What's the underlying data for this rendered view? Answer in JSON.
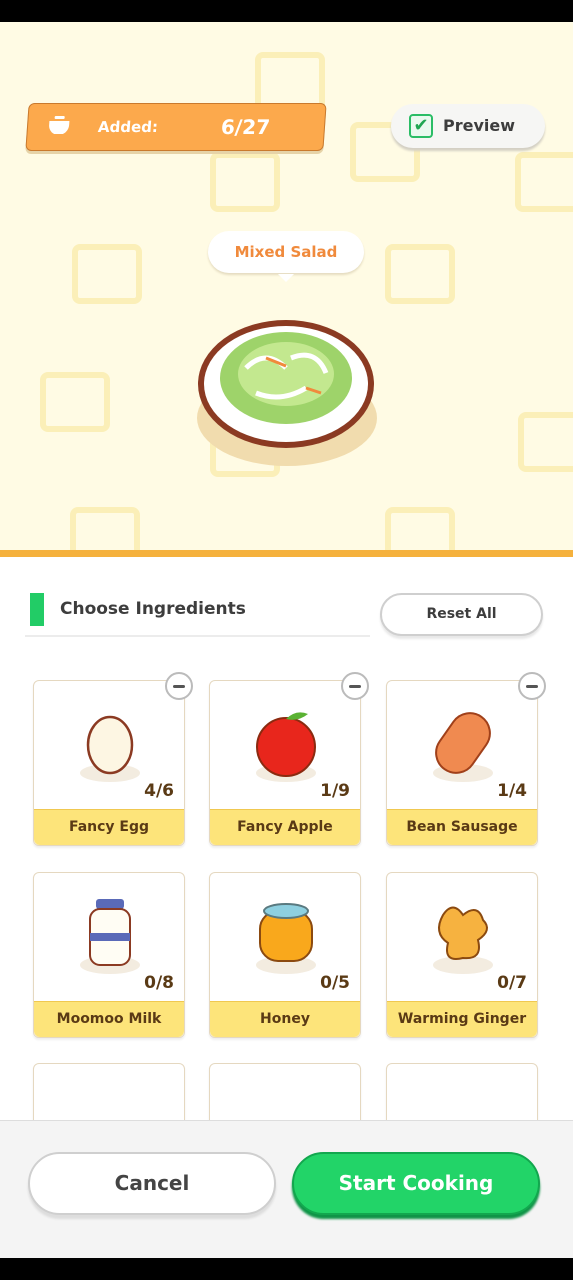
{
  "header": {
    "added_label": "Added:",
    "added_value": "6/27",
    "preview_label": "Preview"
  },
  "dish": {
    "name": "Mixed Salad"
  },
  "section": {
    "title": "Choose Ingredients",
    "reset_label": "Reset All"
  },
  "ingredients": [
    {
      "name": "Fancy Egg",
      "count": "4/6"
    },
    {
      "name": "Fancy Apple",
      "count": "1/9"
    },
    {
      "name": "Bean Sausage",
      "count": "1/4"
    },
    {
      "name": "Moomoo Milk",
      "count": "0/8"
    },
    {
      "name": "Honey",
      "count": "0/5"
    },
    {
      "name": "Warming Ginger",
      "count": "0/7"
    }
  ],
  "footer": {
    "cancel_label": "Cancel",
    "start_label": "Start Cooking"
  },
  "colors": {
    "accent_orange": "#fca94c",
    "accent_green": "#22d468",
    "card_label": "#fde47a"
  }
}
